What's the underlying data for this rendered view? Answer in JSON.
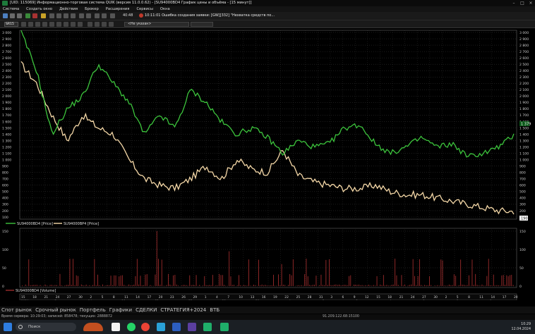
{
  "window": {
    "title": "[UID: 115069] Информационно-торговая система QUIK (версия 11.0.0.62) - [SU94000BD4 График цены и объёма - [15 минут]]"
  },
  "menu": [
    "Система",
    "Создать окно",
    "Действия",
    "Брокер",
    "Расширения",
    "Сервисы",
    "Окна"
  ],
  "toolbar": {
    "time": "40:48",
    "alert_time": "10:11:01",
    "alert_text": "Ошибка создания заявки: [GW][332] \"Нехватка средств по...",
    "security": "SR15",
    "account_placeholder": "<Не указан>"
  },
  "price_axis": {
    "ticks": [
      "3 000",
      "2 900",
      "2 800",
      "2 700",
      "2 600",
      "2 500",
      "2 400",
      "2 300",
      "2 200",
      "2 100",
      "2 000",
      "1 900",
      "1 800",
      "1 700",
      "1 600",
      "1 500",
      "1 400",
      "1 300",
      "1 200",
      "1 100",
      "1 000",
      "900",
      "800",
      "700",
      "600",
      "500",
      "400",
      "300",
      "200",
      "100"
    ],
    "marker_green": "1 379",
    "marker_orange": "190"
  },
  "volume_axis": {
    "ticks": [
      "150",
      "100",
      "50",
      "0"
    ]
  },
  "legend": {
    "green": "SU94000BD4 [Price]",
    "orange": "SU94000BP4 [Price]",
    "volume": "SU94000BD4 [Volume]"
  },
  "x_axis": {
    "top": [
      "15",
      "18",
      "21",
      "24",
      "27",
      "30",
      "2",
      "5",
      "8",
      "11",
      "14",
      "17",
      "20",
      "23",
      "26",
      "29",
      "1",
      "4",
      "7",
      "10",
      "13",
      "16",
      "19",
      "22",
      "25",
      "28",
      "31",
      "3",
      "6",
      "9",
      "12",
      "15",
      "18",
      "21",
      "24",
      "27",
      "30",
      "2",
      "5",
      "8",
      "11",
      "14",
      "17",
      "20"
    ],
    "bottom": [
      "2024",
      "5",
      "14",
      "19",
      "21",
      "25",
      "28",
      "29",
      "Apr",
      "2",
      "3",
      "4",
      "5",
      "8",
      "9"
    ]
  },
  "bottom_tabs": [
    "Спот рынок",
    "Срочный рынок",
    "Портфель",
    "Графики",
    "СДЕЛКИ",
    "СТРАТЕГИЯ+2024",
    "ВТБ"
  ],
  "status": {
    "left": "Время сервера: 10:29:03; записей: 858478; текущих: 2888872",
    "middle": "91.209.122.68:15100"
  },
  "taskbar": {
    "search_placeholder": "Поиск",
    "time": "10:29",
    "date": "12.04.2024"
  },
  "colors": {
    "green_line": "#3cc43c",
    "orange_line": "#f6d9a8",
    "volume_bar": "#9b2b2b",
    "grid": "#4a4a4a"
  },
  "chart_data": {
    "type": "line",
    "series": [
      {
        "name": "SU94000BD4 [Price]",
        "values": [
          3000,
          2400,
          1400,
          1800,
          2000,
          2500,
          2200,
          1900,
          1400,
          1700,
          1500,
          2100,
          1900,
          1600,
          1400,
          1500,
          1350,
          1100,
          1300,
          1200,
          1250,
          1500,
          1550,
          1250,
          1100,
          1200,
          1350,
          1200,
          1250,
          1050,
          1100,
          1200,
          1379
        ]
      },
      {
        "name": "SU94000BP4 [Price]",
        "values": [
          2500,
          2200,
          1700,
          1300,
          1700,
          1500,
          1400,
          1000,
          700,
          600,
          550,
          700,
          900,
          700,
          1000,
          850,
          800,
          1150,
          750,
          650,
          600,
          550,
          550,
          600,
          500,
          450,
          450,
          400,
          350,
          300,
          250,
          200,
          190
        ]
      }
    ],
    "volume_max": 150,
    "ylim": [
      100,
      3000
    ]
  }
}
